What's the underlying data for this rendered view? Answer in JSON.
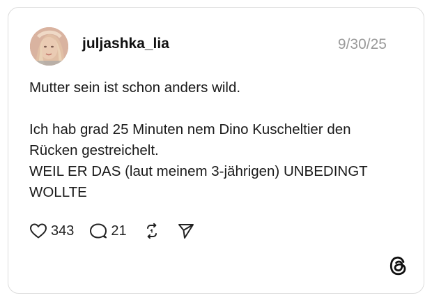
{
  "post": {
    "username": "juljashka_lia",
    "timestamp": "9/30/25",
    "lines": [
      "Mutter sein ist schon anders wild.",
      "",
      "Ich hab grad 25 Minuten nem Dino Kuscheltier den",
      "Rücken gestreichelt.",
      "WEIL ER DAS (laut meinem 3-jährigen) UNBEDINGT",
      "WOLLTE"
    ]
  },
  "actions": {
    "like": {
      "icon": "heart-icon",
      "count": "343"
    },
    "reply": {
      "icon": "comment-icon",
      "count": "21"
    },
    "repost": {
      "icon": "repost-icon"
    },
    "share": {
      "icon": "send-icon"
    }
  },
  "brand": {
    "icon": "threads-logo-icon"
  },
  "colors": {
    "border": "#dcdcdc",
    "text": "#1a1a1a",
    "muted": "#9a9a9a"
  }
}
